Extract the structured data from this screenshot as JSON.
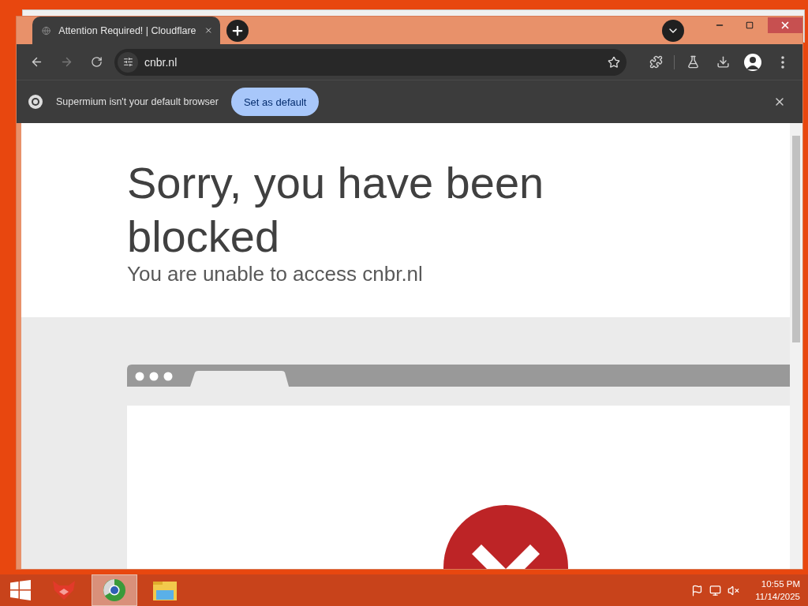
{
  "browser": {
    "tab": {
      "title": "Attention Required! | Cloudflare"
    },
    "address_bar": {
      "value": "cnbr.nl"
    },
    "infobar": {
      "message": "Supermium isn't your default browser",
      "button": "Set as default"
    }
  },
  "page": {
    "heading": "Sorry, you have been blocked",
    "subheading": "You are unable to access cnbr.nl"
  },
  "taskbar": {
    "apps": [
      {
        "kind": "fox",
        "selected": false
      },
      {
        "kind": "browser",
        "selected": true
      },
      {
        "kind": "folder",
        "selected": false
      }
    ],
    "clock": {
      "time": "10:55 PM",
      "date": "11/14/2025"
    }
  }
}
